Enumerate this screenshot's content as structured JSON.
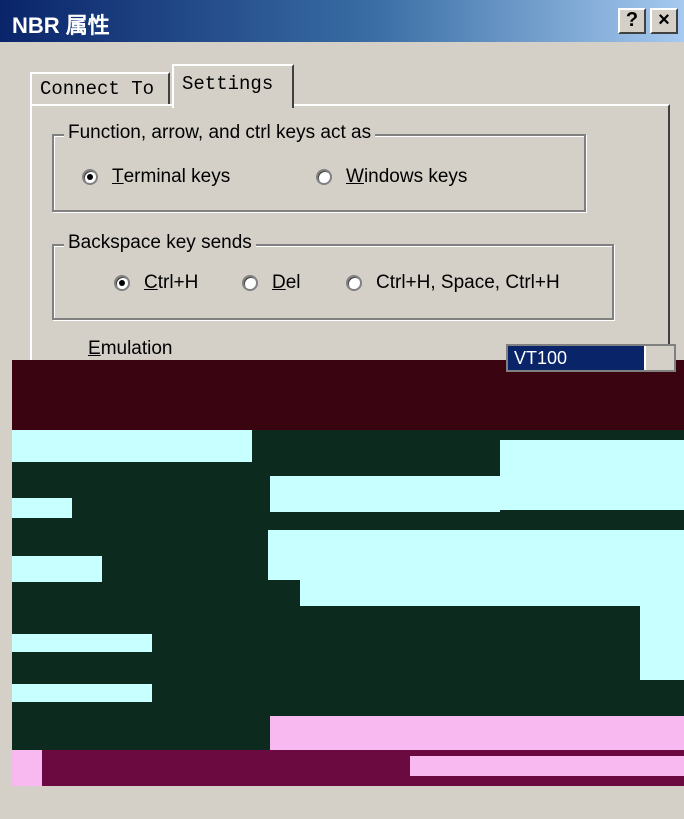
{
  "window": {
    "title": "NBR 属性",
    "help_label": "?",
    "close_label": "×"
  },
  "tabs": [
    {
      "label": "Connect To"
    },
    {
      "label": "Settings"
    }
  ],
  "keys_group": {
    "legend": "Function, arrow, and ctrl keys act as",
    "options": [
      {
        "accel": "T",
        "rest": "erminal keys",
        "selected": true
      },
      {
        "accel": "W",
        "rest": "indows keys",
        "selected": false
      }
    ]
  },
  "backspace_group": {
    "legend": "Backspace key sends",
    "options": [
      {
        "accel": "C",
        "rest": "trl+H",
        "selected": true
      },
      {
        "accel": "D",
        "rest": "el",
        "selected": false
      },
      {
        "accel": "",
        "rest": "Ctrl+H, Space, Ctrl+H",
        "selected": false
      }
    ]
  },
  "emulation": {
    "label_accel": "E",
    "label_rest": "mulation",
    "value": "VT100"
  },
  "colors": {
    "face": "#d4d0c8",
    "title_start": "#0a246a",
    "title_end": "#a6caf0",
    "highlight": "#0a246a"
  }
}
